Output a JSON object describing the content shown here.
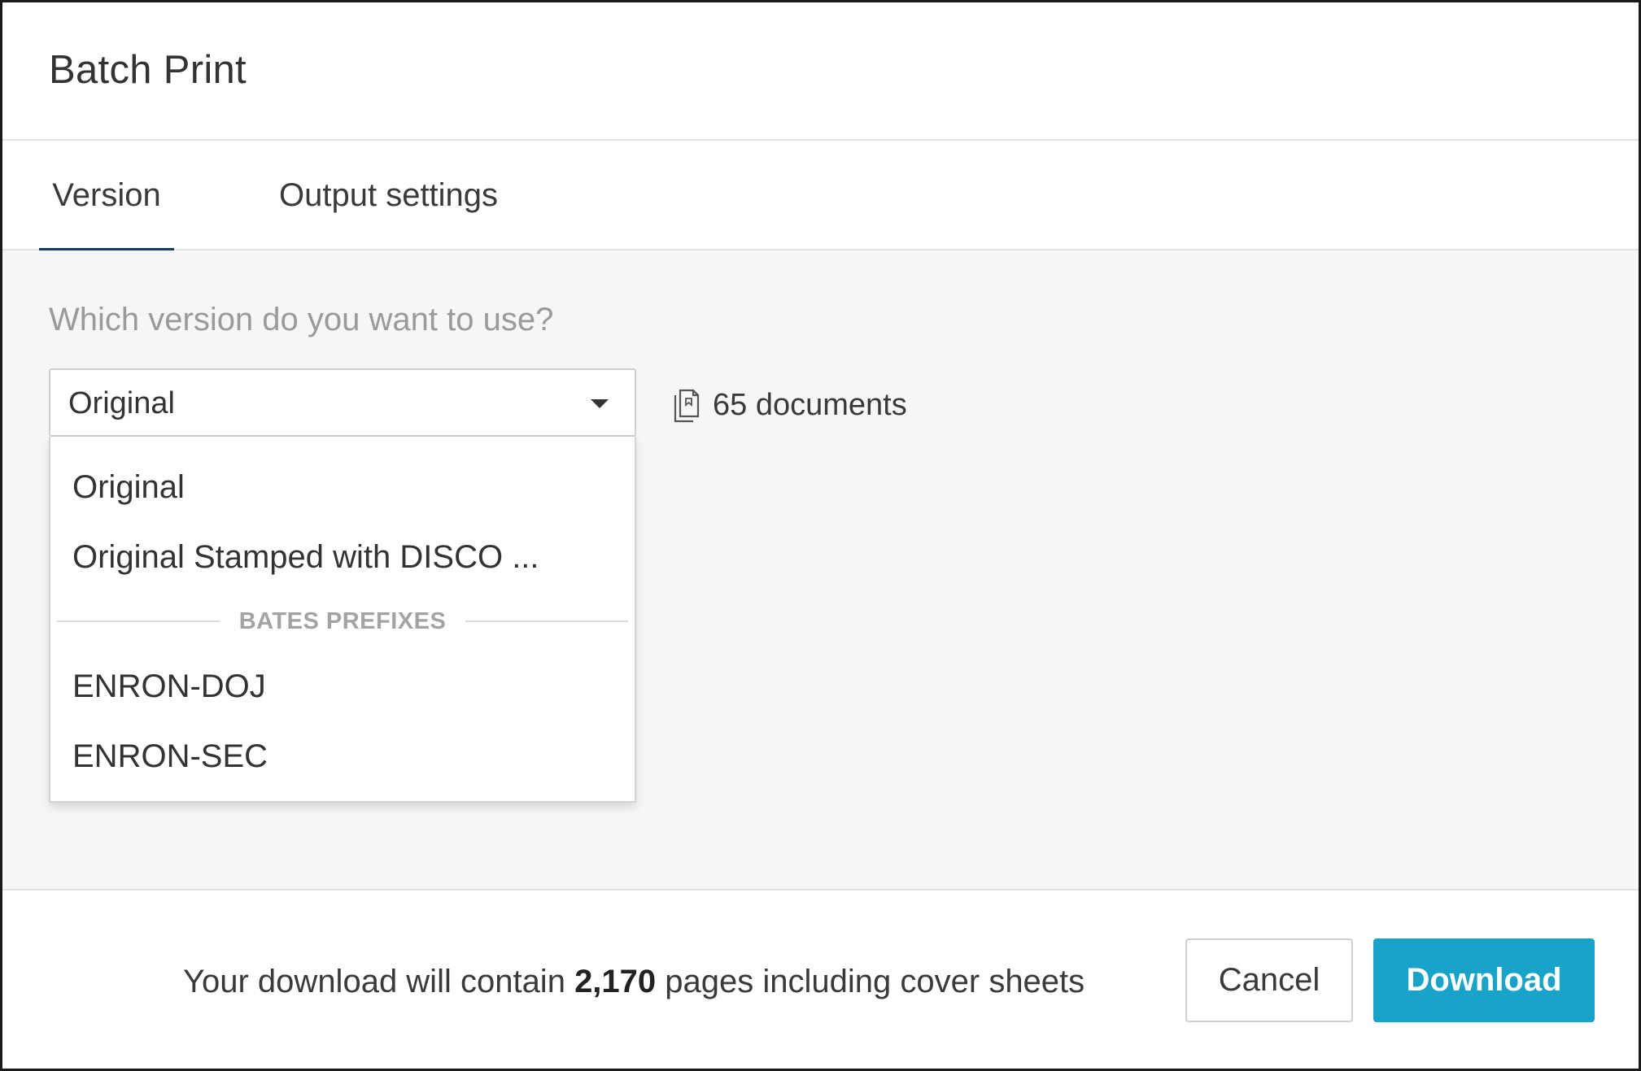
{
  "header": {
    "title": "Batch Print"
  },
  "tabs": [
    {
      "label": "Version",
      "active": true
    },
    {
      "label": "Output settings",
      "active": false
    }
  ],
  "version": {
    "question": "Which version do you want to use?",
    "selected": "Original",
    "document_count": "65 documents",
    "options": [
      "Original",
      "Original Stamped with DISCO ..."
    ],
    "group_label": "BATES PREFIXES",
    "prefix_options": [
      "ENRON-DOJ",
      "ENRON-SEC"
    ]
  },
  "footer": {
    "summary_prefix": "Your download will contain ",
    "summary_pages": "2,170",
    "summary_suffix": " pages including cover sheets",
    "cancel_label": "Cancel",
    "download_label": "Download"
  },
  "colors": {
    "accent": "#1aa3c8",
    "tab_underline": "#0d3b6e",
    "panel_bg": "#f6f6f6"
  },
  "icons": {
    "document_count": "document-stack-icon",
    "select_caret": "caret-down-icon"
  }
}
